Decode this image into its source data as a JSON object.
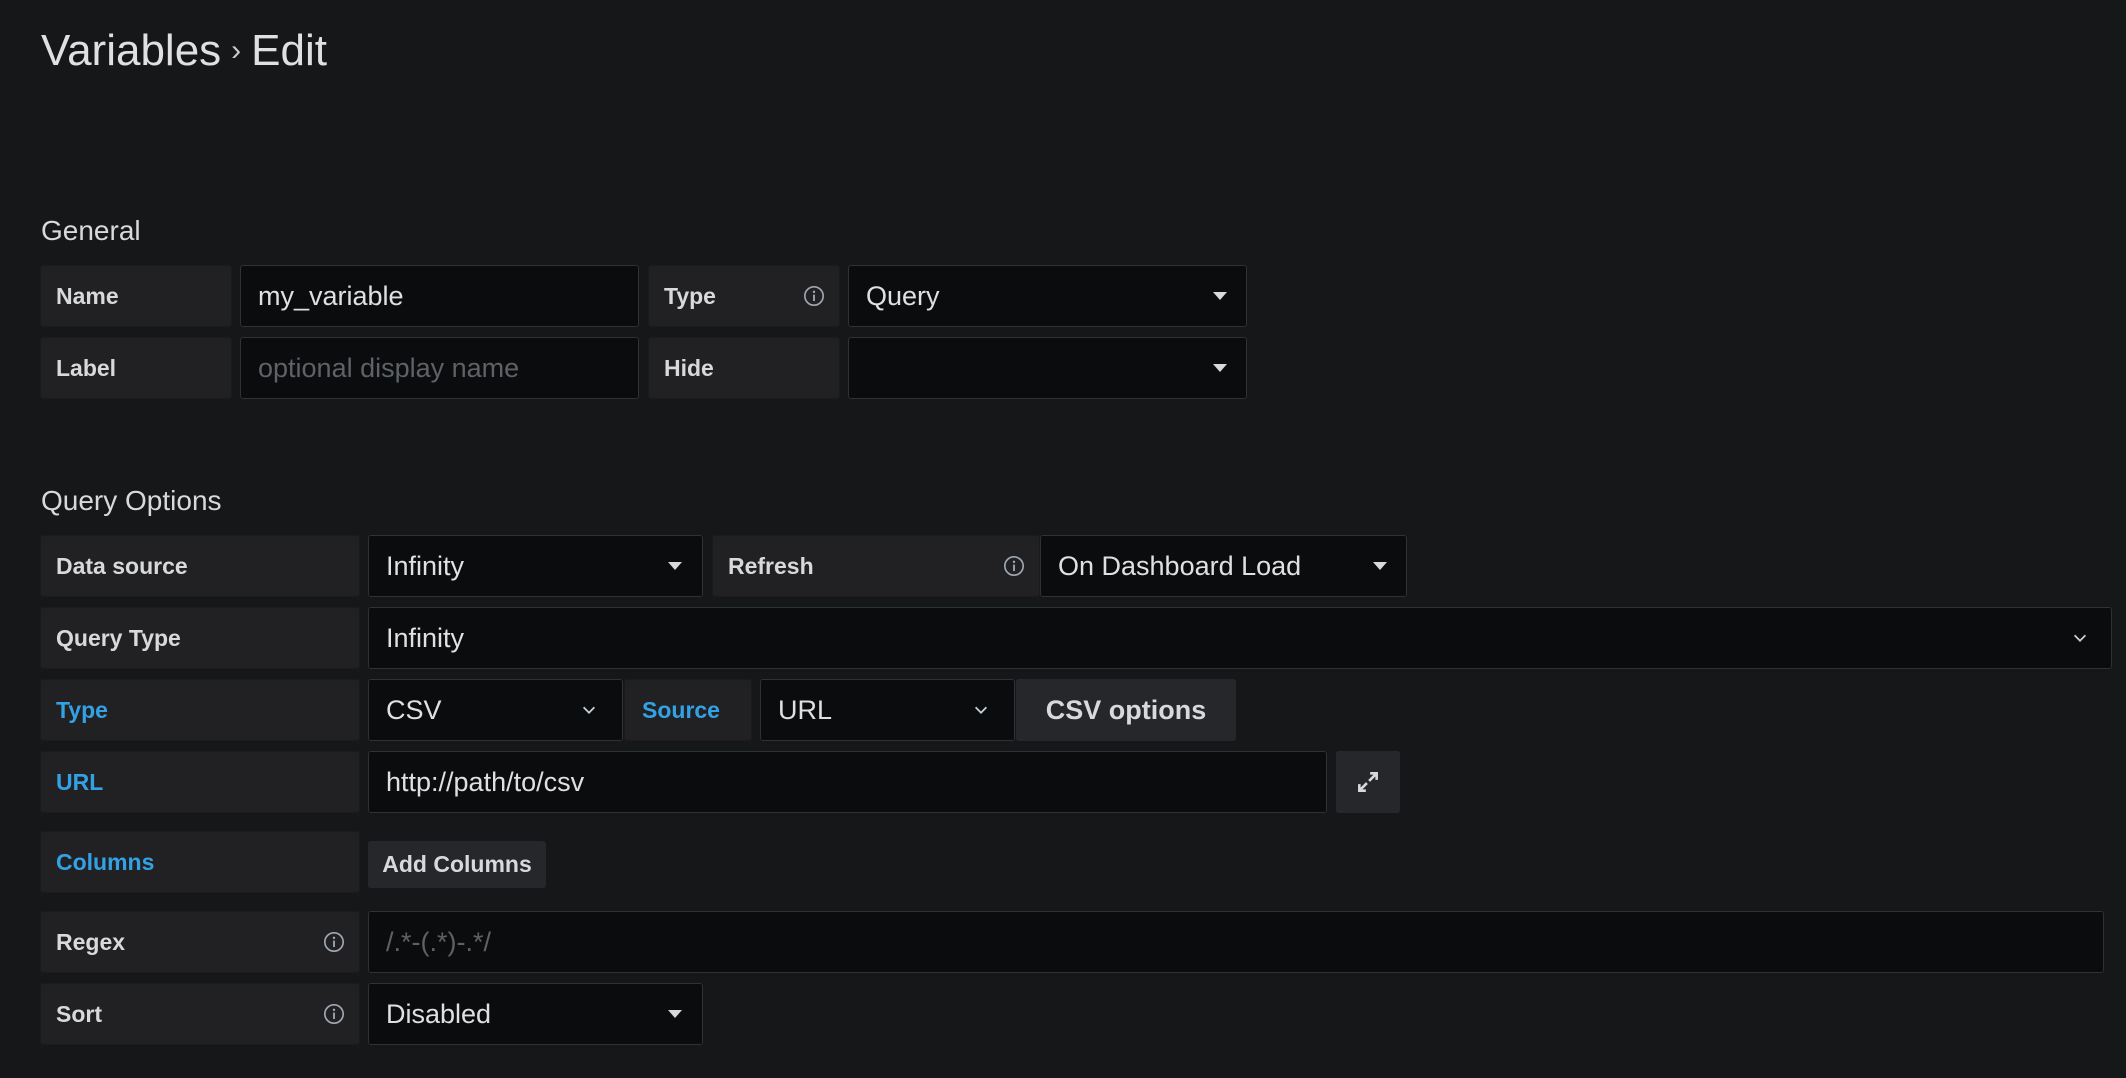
{
  "header": {
    "section": "Variables",
    "separator": "›",
    "page": "Edit"
  },
  "general": {
    "heading": "General",
    "name_label": "Name",
    "name_value": "my_variable",
    "type_label": "Type",
    "type_value": "Query",
    "label_label": "Label",
    "label_placeholder": "optional display name",
    "hide_label": "Hide",
    "hide_value": ""
  },
  "query_options": {
    "heading": "Query Options",
    "datasource_label": "Data source",
    "datasource_value": "Infinity",
    "refresh_label": "Refresh",
    "refresh_value": "On Dashboard Load",
    "query_type_label": "Query Type",
    "query_type_value": "Infinity",
    "type_label": "Type",
    "type_value": "CSV",
    "source_label": "Source",
    "source_value": "URL",
    "csv_options_label": "CSV options",
    "url_label": "URL",
    "url_value": "http://path/to/csv",
    "columns_label": "Columns",
    "add_columns_label": "Add Columns",
    "regex_label": "Regex",
    "regex_placeholder": "/.*-(.*)-.*/",
    "sort_label": "Sort",
    "sort_value": "Disabled"
  },
  "colors": {
    "accent_blue": "#33a2e5",
    "background": "#161719",
    "input_bg": "#0b0c0e",
    "label_bg": "#212124"
  },
  "icons": [
    "info-icon",
    "caret-down-icon",
    "chevron-down-icon",
    "expand-icon"
  ]
}
